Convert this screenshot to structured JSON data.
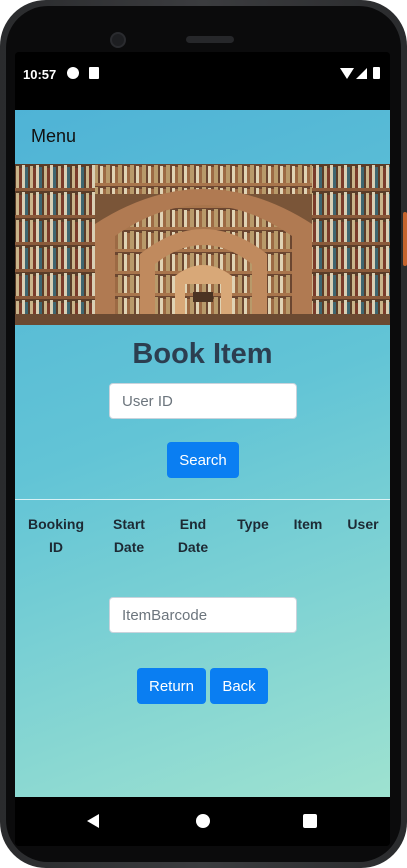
{
  "status": {
    "time": "10:57"
  },
  "app": {
    "menu_label": "Menu",
    "title": "Book Item",
    "user_id_placeholder": "User ID",
    "search_label": "Search",
    "table_headers": [
      {
        "line1": "Booking",
        "line2": "ID"
      },
      {
        "line1": "Start",
        "line2": "Date"
      },
      {
        "line1": "End",
        "line2": "Date"
      },
      {
        "line1": "Type",
        "line2": ""
      },
      {
        "line1": "Item",
        "line2": ""
      },
      {
        "line1": "User",
        "line2": ""
      }
    ],
    "item_barcode_placeholder": "ItemBarcode",
    "return_label": "Return",
    "back_label": "Back"
  },
  "colors": {
    "accent": "#0a7ef2",
    "title": "#2c3e50",
    "gradient_start": "#4fb3d6",
    "gradient_end": "#9ee2d0"
  },
  "icons": {
    "status": [
      "data-saver-icon",
      "sd-card-icon",
      "wifi-icon",
      "signal-icon",
      "battery-icon"
    ],
    "nav": [
      "back-icon",
      "home-icon",
      "recents-icon"
    ]
  }
}
